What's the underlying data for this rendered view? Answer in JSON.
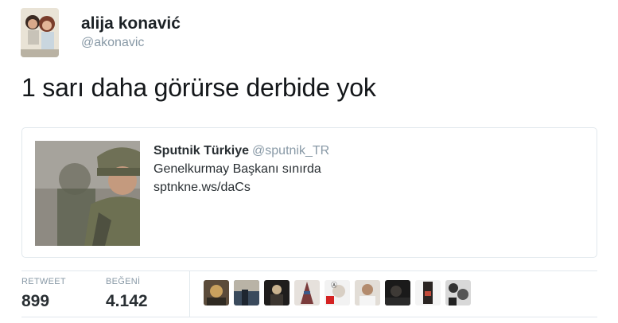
{
  "user": {
    "name": "alija konavić",
    "handle": "@akonavic"
  },
  "tweet": {
    "text": "1 sarı daha görürse derbide yok"
  },
  "quoted_card": {
    "author_name": "Sputnik Türkiye",
    "author_handle": "@sputnik_TR",
    "headline": "Genelkurmay Başkanı sınırda",
    "link": "sptnkne.ws/daCs"
  },
  "stats": {
    "retweet_label": "RETWEET",
    "retweet_count": "899",
    "like_label": "BEĞENİ",
    "like_count": "4.142"
  },
  "likers": [
    {
      "icon": "liker-avatar"
    },
    {
      "icon": "liker-avatar"
    },
    {
      "icon": "liker-avatar"
    },
    {
      "icon": "liker-avatar"
    },
    {
      "icon": "liker-avatar"
    },
    {
      "icon": "liker-avatar"
    },
    {
      "icon": "liker-avatar"
    },
    {
      "icon": "liker-avatar"
    },
    {
      "icon": "liker-avatar"
    }
  ],
  "colors": {
    "handle_gray": "#8899a6",
    "border": "#e1e8ed",
    "text": "#292f33"
  }
}
